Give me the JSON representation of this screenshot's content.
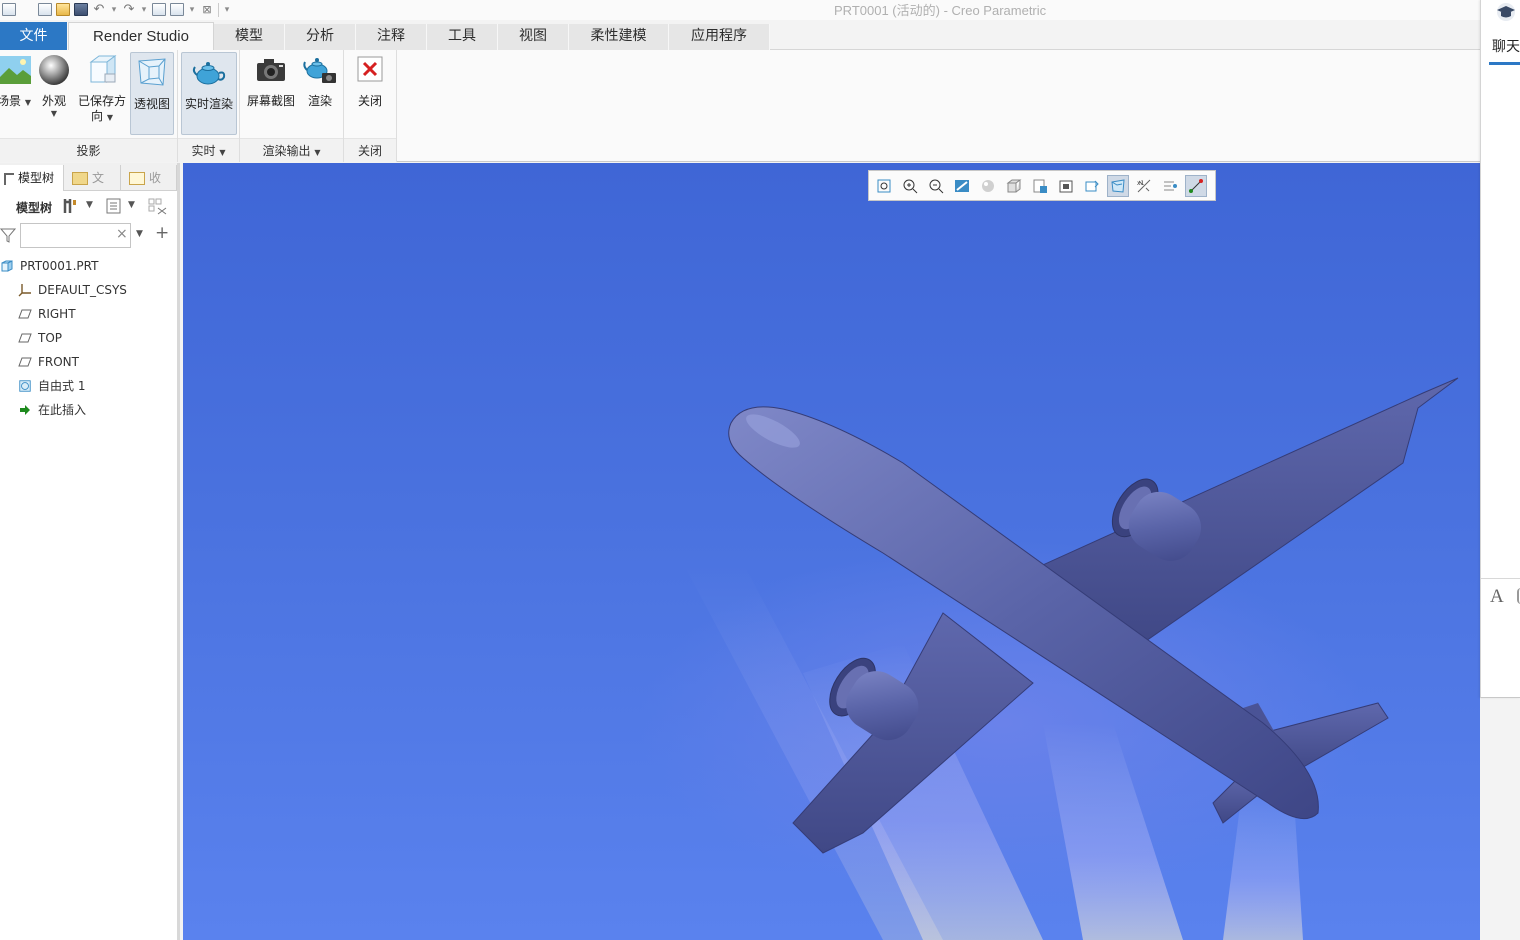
{
  "window": {
    "title": "PRT0001 (活动的) - Creo Parametric"
  },
  "tabs": [
    {
      "label": "文件"
    },
    {
      "label": "Render Studio"
    },
    {
      "label": "模型"
    },
    {
      "label": "分析"
    },
    {
      "label": "注释"
    },
    {
      "label": "工具"
    },
    {
      "label": "视图"
    },
    {
      "label": "柔性建模"
    },
    {
      "label": "应用程序"
    }
  ],
  "ribbon": {
    "groups": [
      {
        "label": "投影",
        "buttons": [
          "场景",
          "外观",
          "已保存方",
          "向",
          "透视图"
        ]
      },
      {
        "label": "实时",
        "buttons": [
          "实时渲染"
        ]
      },
      {
        "label": "渲染输出",
        "buttons": [
          "屏幕截图",
          "渲染"
        ]
      },
      {
        "label": "关闭",
        "buttons": [
          "关闭"
        ]
      }
    ]
  },
  "left_panel": {
    "tabs": [
      "模型树",
      "文",
      "收"
    ],
    "toolbar_label": "模型树",
    "search": {
      "value": "",
      "clear_glyph": "×"
    },
    "tree": [
      {
        "label": "PRT0001.PRT",
        "icon": "part-icon"
      },
      {
        "label": "DEFAULT_CSYS",
        "icon": "csys-icon"
      },
      {
        "label": "RIGHT",
        "icon": "datum-plane-icon"
      },
      {
        "label": "TOP",
        "icon": "datum-plane-icon"
      },
      {
        "label": "FRONT",
        "icon": "datum-plane-icon"
      },
      {
        "label": "自由式 1",
        "icon": "freestyle-icon"
      },
      {
        "label": "在此插入",
        "icon": "insert-arrow-icon"
      }
    ]
  },
  "right_panel": {
    "tab_label": "聊天",
    "font_glyph": "A"
  },
  "colors": {
    "file_tab": "#2c78c5",
    "viewport_sky": "#4a72df",
    "airplane": "#5a64a8",
    "close_red": "#d62020",
    "insert_green": "#1e8a1e"
  }
}
